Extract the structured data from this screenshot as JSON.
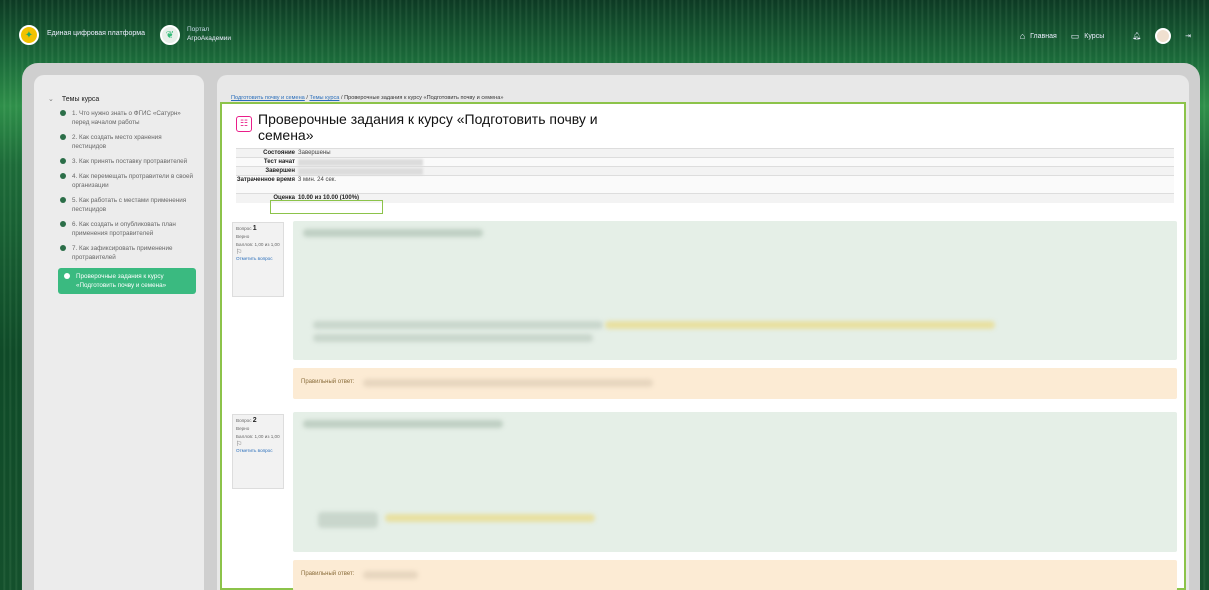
{
  "header": {
    "brand1": "Единая цифровая платформа",
    "brand2_line1": "Портал",
    "brand2_line2": "АгроАкадемии",
    "nav_home": "Главная",
    "nav_courses": "Курсы"
  },
  "sidebar": {
    "heading": "Темы курса",
    "items": [
      {
        "label": "1. Что нужно знать о ФГИС «Сатурн» перед началом работы"
      },
      {
        "label": "2. Как создать место хранения пестицидов"
      },
      {
        "label": "3. Как принять поставку протравителей"
      },
      {
        "label": "4. Как перемещать протравители в своей организации"
      },
      {
        "label": "5. Как работать с местами применения пестицидов"
      },
      {
        "label": "6. Как создать и опубликовать план применения протравителей"
      },
      {
        "label": "7. Как зафиксировать применение протравителей"
      }
    ],
    "active": "Проверочные задания к курсу «Подготовить почву и семена»"
  },
  "breadcrumb": {
    "c1": "Подготовить почву и семена",
    "sep": "/",
    "c2": "Темы курса",
    "c3": "Проверочные задания к курсу «Подготовить почву и семена»"
  },
  "page": {
    "title": "Проверочные задания к курсу «Подготовить почву и семена»"
  },
  "summary": {
    "state_k": "Состояние",
    "state_v": "Завершены",
    "started_k": "Тест начат",
    "finished_k": "Завершен",
    "time_k": "Затраченное время",
    "time_v": "3 мин. 24 сек.",
    "grade_k": "Оценка",
    "grade_v": "10.00 из 10.00 (100%)"
  },
  "questions": [
    {
      "label": "Вопрос",
      "num": "1",
      "status": "Верно",
      "score": "Баллов: 1,00 из 1,00",
      "flag": "Отметить вопрос",
      "answer_label": "Правильный ответ:"
    },
    {
      "label": "Вопрос",
      "num": "2",
      "status": "Верно",
      "score": "Баллов: 1,00 из 1,00",
      "flag": "Отметить вопрос",
      "answer_label": "Правильный ответ:"
    }
  ]
}
